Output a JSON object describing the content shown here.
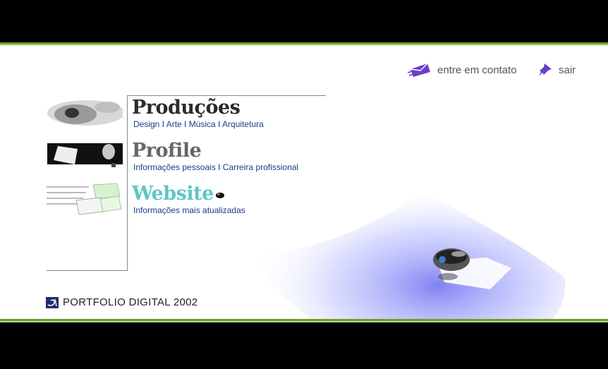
{
  "nav": {
    "contact_label": "entre em contato",
    "logout_label": "sair"
  },
  "sections": [
    {
      "title": "Produções",
      "subtitle": "Design I Arte I Música I Arquitetura"
    },
    {
      "title": "Profile",
      "subtitle": "Informações pessoais I Carreira profissional"
    },
    {
      "title": "Website",
      "subtitle": "Informações mais atualizadas"
    }
  ],
  "footer": {
    "brand": "PORTFOLIO DIGITAL 2002"
  },
  "colors": {
    "accent_green": "#6fa02a",
    "link_blue": "#1a3a8a",
    "website_teal": "#5ec6c8",
    "icon_purple": "#6a3fc8"
  },
  "icons": [
    "envelope-icon",
    "pushpin-icon",
    "logo-icon"
  ]
}
